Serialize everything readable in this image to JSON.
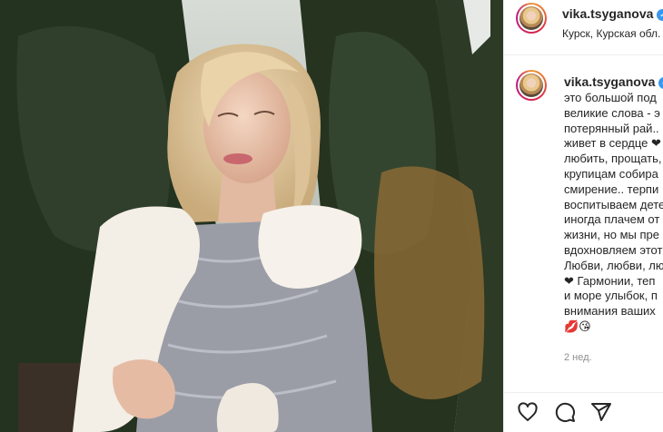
{
  "post": {
    "username": "vika.tsyganova",
    "verified_icon": "verified-badge-icon",
    "location": "Курск, Курская обл.",
    "photo_icon": "post-photo"
  },
  "caption": {
    "username": "vika.tsyganova",
    "lines": [
      "это большой под",
      "великие слова - э",
      "потерянный рай..",
      "живет в сердце ❤",
      "любить, прощать,",
      "крупицам собира",
      "смирение.. терпи",
      "воспитываем дете",
      "иногда плачем от",
      "жизни, но мы пре",
      "вдохновляем этот",
      "Любви, любви, лю",
      "❤ Гармонии, теп",
      "и море улыбок, п",
      "внимания ваших",
      "💋😘"
    ]
  },
  "time": "2 нед.",
  "actions": {
    "like_icon": "heart-icon",
    "comment_icon": "comment-icon",
    "share_icon": "share-icon"
  },
  "colors": {
    "verified": "#3897f0",
    "text": "#262626",
    "muted": "#8e8e8e",
    "divider": "#efefef"
  }
}
